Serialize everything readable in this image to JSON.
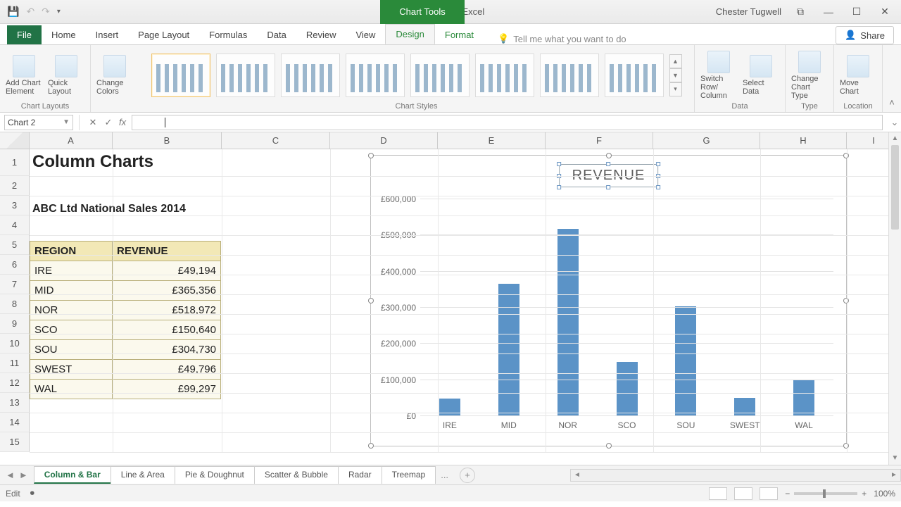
{
  "titlebar": {
    "title": "CHARTS - Excel",
    "chart_tools": "Chart Tools",
    "user": "Chester Tugwell"
  },
  "tabs": {
    "file": "File",
    "home": "Home",
    "insert": "Insert",
    "pagelayout": "Page Layout",
    "formulas": "Formulas",
    "data": "Data",
    "review": "Review",
    "view": "View",
    "design": "Design",
    "format": "Format",
    "tellme": "Tell me what you want to do",
    "share": "Share"
  },
  "ribbon": {
    "chart_layouts": "Chart Layouts",
    "add_chart_element": "Add Chart Element",
    "quick_layout": "Quick Layout",
    "change_colors": "Change Colors",
    "chart_styles": "Chart Styles",
    "switch": "Switch Row/ Column",
    "select_data": "Select Data",
    "data": "Data",
    "change_type": "Change Chart Type",
    "type": "Type",
    "move_chart": "Move Chart",
    "location": "Location"
  },
  "fbar": {
    "name": "Chart 2",
    "value": ""
  },
  "columns": {
    "A": "A",
    "B": "B",
    "C": "C",
    "D": "D",
    "E": "E",
    "F": "F",
    "G": "G",
    "H": "H",
    "I": "I"
  },
  "col_widths": {
    "A": 118,
    "B": 155,
    "C": 154,
    "D": 153,
    "E": 153,
    "F": 153,
    "G": 152,
    "H": 123,
    "I": 77
  },
  "rows": [
    "1",
    "2",
    "3",
    "4",
    "5",
    "6",
    "7",
    "8",
    "9",
    "10",
    "11",
    "12",
    "13",
    "14",
    "15"
  ],
  "content": {
    "title": "Column  Charts",
    "subtitle": "ABC Ltd National Sales 2014",
    "header_region": "REGION",
    "header_revenue": "REVENUE",
    "table": [
      {
        "region": "IRE",
        "revenue": "£49,194"
      },
      {
        "region": "MID",
        "revenue": "£365,356"
      },
      {
        "region": "NOR",
        "revenue": "£518,972"
      },
      {
        "region": "SCO",
        "revenue": "£150,640"
      },
      {
        "region": "SOU",
        "revenue": "£304,730"
      },
      {
        "region": "SWEST",
        "revenue": "£49,796"
      },
      {
        "region": "WAL",
        "revenue": "£99,297"
      }
    ]
  },
  "chart_data": {
    "type": "bar",
    "title": "REVENUE",
    "xlabel": "",
    "ylabel": "",
    "ylim": [
      0,
      600000
    ],
    "yticks": [
      "£0",
      "£100,000",
      "£200,000",
      "£300,000",
      "£400,000",
      "£500,000",
      "£600,000"
    ],
    "categories": [
      "IRE",
      "MID",
      "NOR",
      "SCO",
      "SOU",
      "SWEST",
      "WAL"
    ],
    "values": [
      49194,
      365356,
      518972,
      150640,
      304730,
      49796,
      99297
    ]
  },
  "sheet_tabs": {
    "items": [
      "Column & Bar",
      "Line & Area",
      "Pie & Doughnut",
      "Scatter & Bubble",
      "Radar",
      "Treemap"
    ],
    "more": "...",
    "active_index": 0
  },
  "status": {
    "mode": "Edit",
    "zoom": "100%"
  }
}
